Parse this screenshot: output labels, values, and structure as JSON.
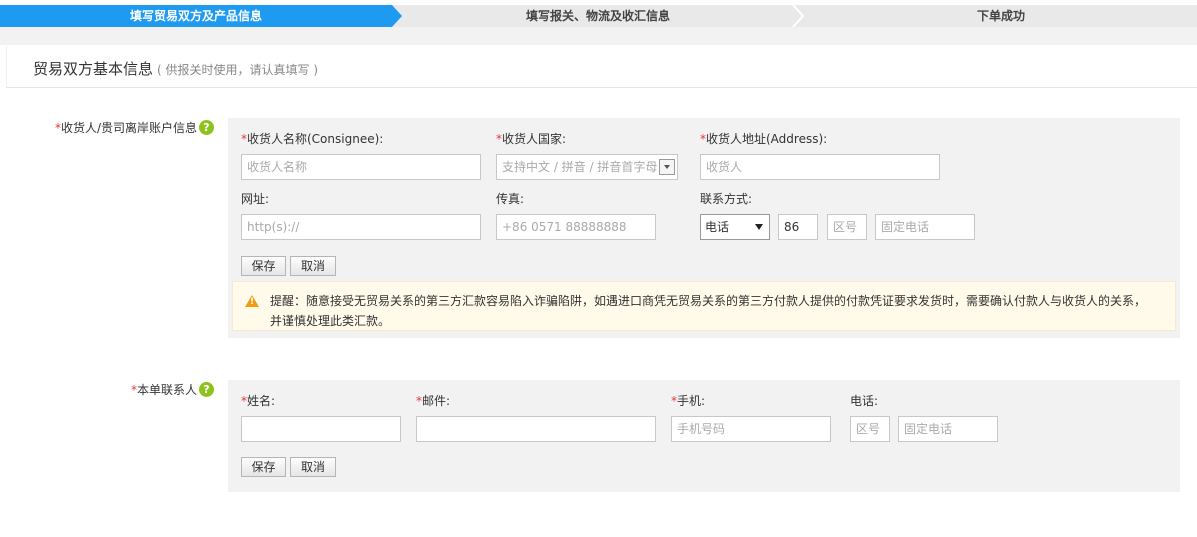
{
  "steps": [
    {
      "label": "填写贸易双方及产品信息",
      "active": true
    },
    {
      "label": "填写报关、物流及收汇信息",
      "active": false
    },
    {
      "label": "下单成功",
      "active": false
    }
  ],
  "section": {
    "title": "贸易双方基本信息",
    "subtitle": "( 供报关时使用，请认真填写 )"
  },
  "consignee": {
    "label": "收货人/贵司离岸账户信息",
    "help": "?",
    "name_label": "收货人名称(Consignee):",
    "name_placeholder": "收货人名称",
    "country_label": "收货人国家:",
    "country_placeholder": "支持中文 / 拼音 / 拼音首字母",
    "address_label": "收货人地址(Address):",
    "address_placeholder": "收货人",
    "website_label": "网址:",
    "website_placeholder": "http(s)://",
    "fax_label": "传真:",
    "fax_placeholder": "+86 0571 88888888",
    "contact_label": "联系方式:",
    "contact_type": "电话",
    "country_code": "86",
    "area_code_placeholder": "区号",
    "phone_placeholder": "固定电话",
    "save": "保存",
    "cancel": "取消",
    "notice_line1": "提醒：随意接受无贸易关系的第三方汇款容易陷入诈骗陷阱，如遇进口商凭无贸易关系的第三方付款人提供的付款凭证要求发货时，需要确认付款人与收货人的关系，",
    "notice_line2": "并谨慎处理此类汇款。"
  },
  "contact": {
    "label": "本单联系人",
    "help": "?",
    "name_label": "姓名:",
    "email_label": "邮件:",
    "mobile_label": "手机:",
    "mobile_placeholder": "手机号码",
    "phone_label": "电话:",
    "area_code_placeholder": "区号",
    "phone_placeholder": "固定电话",
    "save": "保存",
    "cancel": "取消"
  },
  "colors": {
    "active_step": "#1e9bf0",
    "required": "#e4393c",
    "help_icon": "#8dc21f",
    "warning": "#f39c12"
  }
}
